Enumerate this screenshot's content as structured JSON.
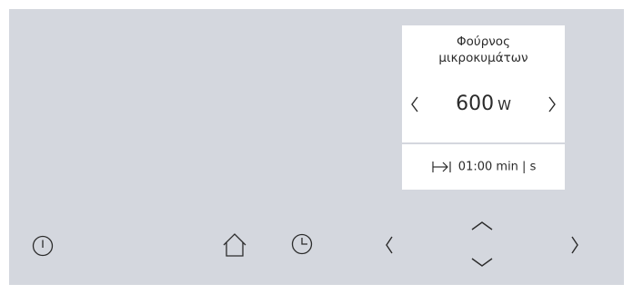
{
  "display": {
    "mode_line1": "Φούρνος",
    "mode_line2": "μικροκυμάτων",
    "power_value": "600",
    "power_unit": "W",
    "timer_value": "01:00",
    "timer_unit": "min | s"
  },
  "icons": {
    "power": "power-icon",
    "home": "home-icon",
    "clock": "clock-icon",
    "left": "chevron-left-icon",
    "right": "chevron-right-icon",
    "up": "chevron-up-icon",
    "down": "chevron-down-icon",
    "duration": "duration-icon"
  },
  "colors": {
    "panel": "#d4d7de",
    "card": "#ffffff",
    "text": "#2b2b2b"
  }
}
